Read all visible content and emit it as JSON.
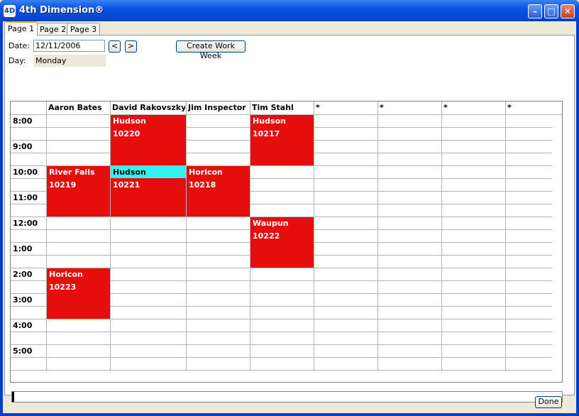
{
  "window": {
    "title": "4th Dimension®",
    "app_icon": "4D"
  },
  "tabs": [
    "Page 1",
    "Page 2",
    "Page 3"
  ],
  "form": {
    "date_label": "Date:",
    "date_value": "12/11/2006",
    "day_label": "Day:",
    "day_value": "Monday",
    "prev_label": "<",
    "next_label": ">",
    "create_week_label": "Create Work Week"
  },
  "schedule": {
    "columns": [
      "Aaron Bates",
      "David Rakovszky",
      "Jim Inspector",
      "Tim Stahl",
      "*",
      "*",
      "*",
      "*"
    ],
    "times": [
      "8:00",
      "9:00",
      "10:00",
      "11:00",
      "12:00",
      "1:00",
      "2:00",
      "3:00",
      "4:00",
      "5:00"
    ],
    "appointments": [
      {
        "column": "David Rakovszky",
        "start": "8:00",
        "end": "10:00",
        "location": "Hudson",
        "number": "10220",
        "color": "#e60d0d"
      },
      {
        "column": "Tim Stahl",
        "start": "8:00",
        "end": "10:00",
        "location": "Hudson",
        "number": "10217",
        "color": "#e60d0d"
      },
      {
        "column": "Aaron Bates",
        "start": "10:00",
        "end": "12:00",
        "location": "River Falls",
        "number": "10219",
        "color": "#e60d0d"
      },
      {
        "column": "David Rakovszky",
        "start": "10:00",
        "end": "12:00",
        "location": "Hudson",
        "number": "10221",
        "color": "#e60d0d",
        "highlight_color": "#33f2f2"
      },
      {
        "column": "Jim Inspector",
        "start": "10:00",
        "end": "12:00",
        "location": "Horicon",
        "number": "10218",
        "color": "#e60d0d"
      },
      {
        "column": "Tim Stahl",
        "start": "12:00",
        "end": "2:00",
        "location": "Waupun",
        "number": "10222",
        "color": "#e60d0d"
      },
      {
        "column": "Aaron Bates",
        "start": "2:00",
        "end": "4:00",
        "location": "Horicon",
        "number": "10223",
        "color": "#e60d0d"
      }
    ]
  },
  "done_label": "Done"
}
